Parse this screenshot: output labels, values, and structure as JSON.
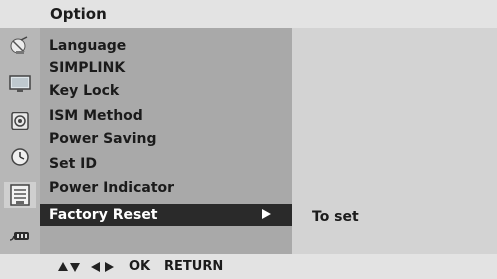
{
  "title": "Option",
  "sidebar": {
    "icons": [
      "satellite-dish-icon",
      "monitor-icon",
      "speaker-icon",
      "clock-icon",
      "option-icon",
      "input-plug-icon"
    ],
    "selected": "option-icon"
  },
  "menu": {
    "items": [
      {
        "label": "Language"
      },
      {
        "label": "SIMPLINK"
      },
      {
        "label": "Key Lock"
      },
      {
        "label": "ISM Method"
      },
      {
        "label": "Power Saving"
      },
      {
        "label": "Set ID"
      },
      {
        "label": "Power Indicator"
      },
      {
        "label": "Factory Reset"
      }
    ],
    "selected": "Factory Reset"
  },
  "submenu": {
    "text": "To set"
  },
  "footer": {
    "arrow_icons": [
      "up-arrow-icon",
      "down-arrow-icon",
      "left-arrow-icon",
      "right-arrow-icon"
    ],
    "ok_label": "OK",
    "return_label": "RETURN"
  },
  "colors": {
    "title_bar": "#e3e3e3",
    "sidebar": "#b7b7b7",
    "menu": "#a9a9a9",
    "highlight": "#2a2a2a",
    "right_panel": "#d3d3d3"
  }
}
